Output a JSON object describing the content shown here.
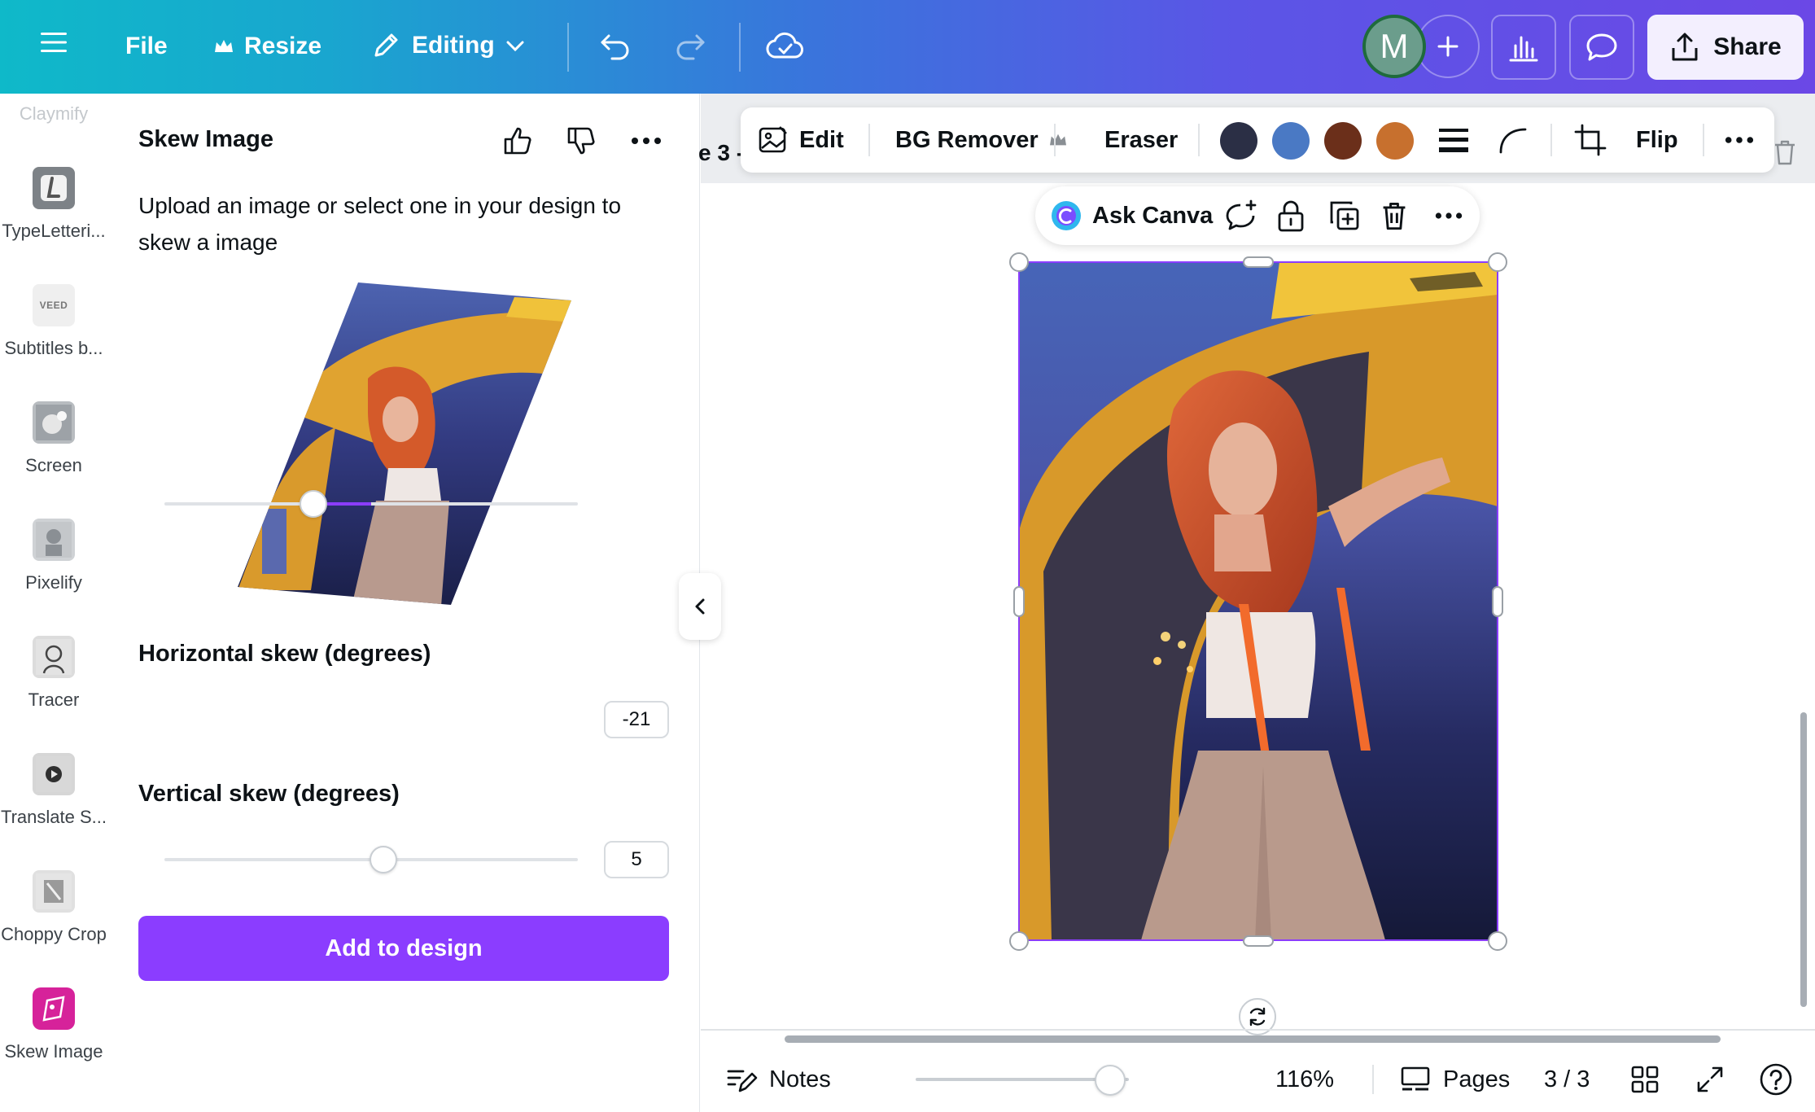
{
  "topbar": {
    "file_label": "File",
    "resize_label": "Resize",
    "editing_label": "Editing",
    "avatar_initial": "M",
    "share_label": "Share"
  },
  "rail": {
    "top_partial_label": "Claymify",
    "items": [
      {
        "label": "TypeLetteri...",
        "icon": "typelettering-icon"
      },
      {
        "label": "Subtitles b...",
        "icon": "veed-icon",
        "icon_text": "VEED"
      },
      {
        "label": "Screen",
        "icon": "screen-icon"
      },
      {
        "label": "Pixelify",
        "icon": "pixelify-icon"
      },
      {
        "label": "Tracer",
        "icon": "tracer-icon"
      },
      {
        "label": "Translate S...",
        "icon": "translate-icon"
      },
      {
        "label": "Choppy Crop",
        "icon": "choppy-crop-icon"
      },
      {
        "label": "Skew Image",
        "icon": "skew-image-icon"
      }
    ]
  },
  "panel": {
    "title": "Skew Image",
    "description": "Upload an image or select one in your design to skew a image",
    "horizontal_label": "Horizontal skew (degrees)",
    "horizontal_value": "-21",
    "horizontal_fraction": 0.36,
    "vertical_label": "Vertical skew (degrees)",
    "vertical_value": "5",
    "vertical_fraction": 0.53,
    "add_button": "Add to design"
  },
  "canvas": {
    "page_label": "e 3 -",
    "toolbar": {
      "edit": "Edit",
      "bg_remover": "BG Remover",
      "eraser": "Eraser",
      "flip": "Flip",
      "swatches": [
        "#2b2f45",
        "#4a79c4",
        "#6b2f1a",
        "#c7702e"
      ]
    },
    "float_bar": {
      "ask_canva": "Ask Canva"
    }
  },
  "bottombar": {
    "notes_label": "Notes",
    "zoom_percent": "116%",
    "pages_label": "Pages",
    "page_counter": "3 / 3"
  },
  "colors": {
    "accent": "#8b3dff"
  }
}
